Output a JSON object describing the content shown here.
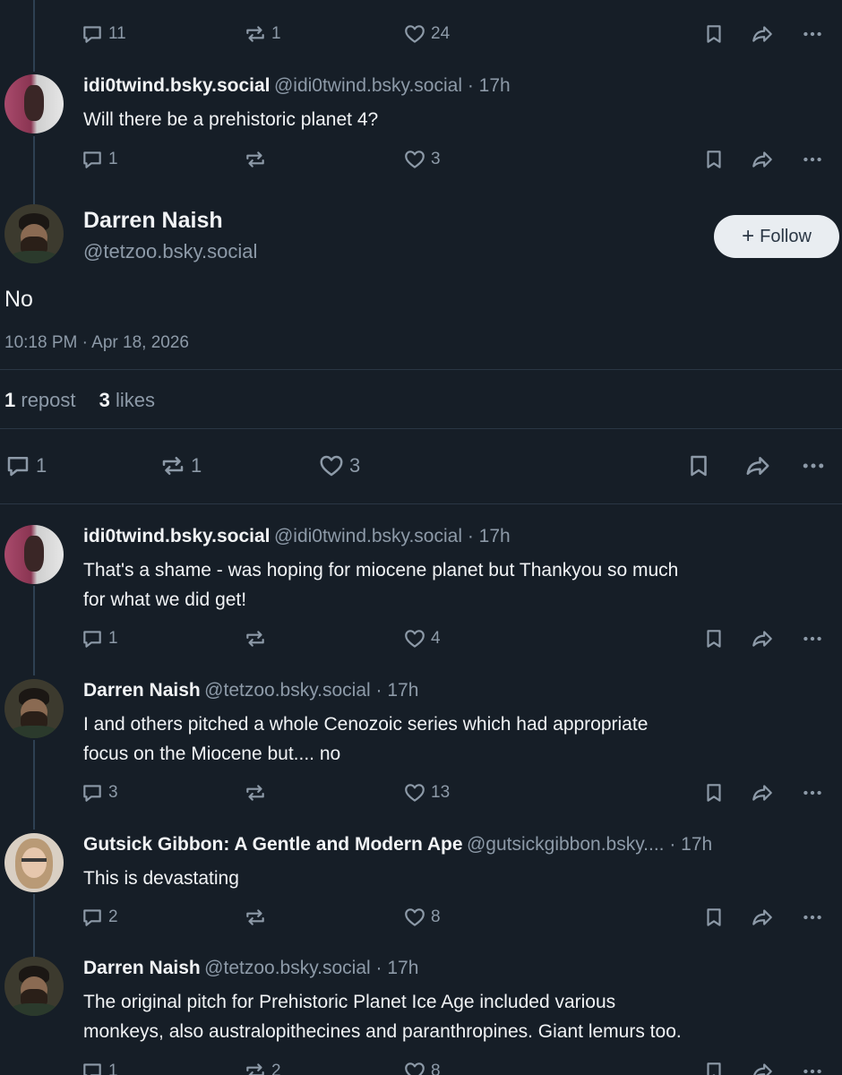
{
  "top_post": {
    "reply_count": "11",
    "repost_count": "1",
    "like_count": "24"
  },
  "reply1": {
    "display_name": "idi0twind.bsky.social",
    "handle_time": "@idi0twind.bsky.social · 17h",
    "text": "Will there be a prehistoric planet 4?",
    "reply_count": "1",
    "repost_count": "",
    "like_count": "3"
  },
  "main_post": {
    "display_name": "Darren Naish",
    "handle": "@tetzoo.bsky.social",
    "follow_label": "Follow",
    "text": "No",
    "timestamp": "10:18 PM · Apr 18, 2026",
    "repost_stat_num": "1",
    "repost_stat_label": "repost",
    "like_stat_num": "3",
    "like_stat_label": "likes",
    "reply_count": "1",
    "repost_count": "1",
    "like_count": "3"
  },
  "replies": [
    {
      "display_name": "idi0twind.bsky.social",
      "handle_time": "@idi0twind.bsky.social · 17h",
      "text_line1": "That's a shame - was hoping for miocene planet but Thankyou so much",
      "text_line2": "for what we did get!",
      "reply_count": "1",
      "repost_count": "",
      "like_count": "4"
    },
    {
      "display_name": "Darren Naish",
      "handle_time": "@tetzoo.bsky.social · 17h",
      "text_line1": "I and others pitched a whole Cenozoic series which had appropriate",
      "text_line2": "focus on the Miocene but.... no",
      "reply_count": "3",
      "repost_count": "",
      "like_count": "13"
    },
    {
      "display_name": "Gutsick Gibbon: A Gentle and Modern Ape",
      "handle_time": "@gutsickgibbon.bsky.... · 17h",
      "text_line1": "This is devastating",
      "text_line2": "",
      "reply_count": "2",
      "repost_count": "",
      "like_count": "8"
    },
    {
      "display_name": "Darren Naish",
      "handle_time": "@tetzoo.bsky.social · 17h",
      "text_line1": "The original pitch for Prehistoric Planet Ice Age included various",
      "text_line2": "monkeys, also australopithecines and paranthropines. Giant lemurs too.",
      "reply_count": "1",
      "repost_count": "2",
      "like_count": "8"
    }
  ],
  "icons": {
    "reply": "speech-bubble-icon",
    "repost": "repost-arrows-icon",
    "like": "heart-icon",
    "bookmark": "bookmark-icon",
    "share": "share-arrow-icon",
    "more": "ellipsis-icon"
  },
  "colors": {
    "background": "#161e27",
    "text": "#f1f3f5",
    "muted": "#8d9aa8",
    "thread_line": "#2e4052",
    "follow_bg": "#e9edf1"
  }
}
